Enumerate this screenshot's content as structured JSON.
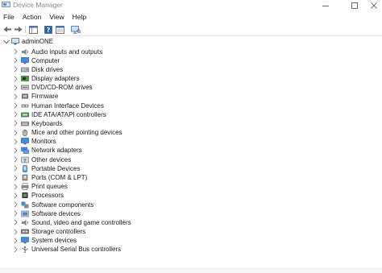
{
  "window": {
    "title": "Device Manager"
  },
  "menu": [
    "File",
    "Action",
    "View",
    "Help"
  ],
  "tree": {
    "root": "adminONE",
    "categories": [
      {
        "label": "Audio inputs and outputs",
        "icon": "speaker-icon"
      },
      {
        "label": "Computer",
        "icon": "monitor-icon"
      },
      {
        "label": "Disk drives",
        "icon": "disk-drive-icon"
      },
      {
        "label": "Display adapters",
        "icon": "display-adapter-icon"
      },
      {
        "label": "DVD/CD-ROM drives",
        "icon": "optical-drive-icon"
      },
      {
        "label": "Firmware",
        "icon": "firmware-icon"
      },
      {
        "label": "Human Interface Devices",
        "icon": "hid-icon"
      },
      {
        "label": "IDE ATA/ATAPI controllers",
        "icon": "ide-controller-icon"
      },
      {
        "label": "Keyboards",
        "icon": "keyboard-icon"
      },
      {
        "label": "Mice and other pointing devices",
        "icon": "mouse-icon"
      },
      {
        "label": "Monitors",
        "icon": "monitor-icon"
      },
      {
        "label": "Network adapters",
        "icon": "network-icon"
      },
      {
        "label": "Other devices",
        "icon": "unknown-device-icon"
      },
      {
        "label": "Portable Devices",
        "icon": "portable-device-icon"
      },
      {
        "label": "Ports (COM & LPT)",
        "icon": "port-icon"
      },
      {
        "label": "Print queues",
        "icon": "printer-icon"
      },
      {
        "label": "Processors",
        "icon": "processor-icon"
      },
      {
        "label": "Software components",
        "icon": "software-component-icon"
      },
      {
        "label": "Software devices",
        "icon": "software-device-icon"
      },
      {
        "label": "Sound, video and game controllers",
        "icon": "speaker-icon"
      },
      {
        "label": "Storage controllers",
        "icon": "storage-controller-icon"
      },
      {
        "label": "System devices",
        "icon": "system-device-icon"
      },
      {
        "label": "Universal Serial Bus controllers",
        "icon": "usb-icon"
      }
    ]
  },
  "colors": {
    "accent": "#1f6fd1",
    "chevron": "#7a7a7a"
  }
}
